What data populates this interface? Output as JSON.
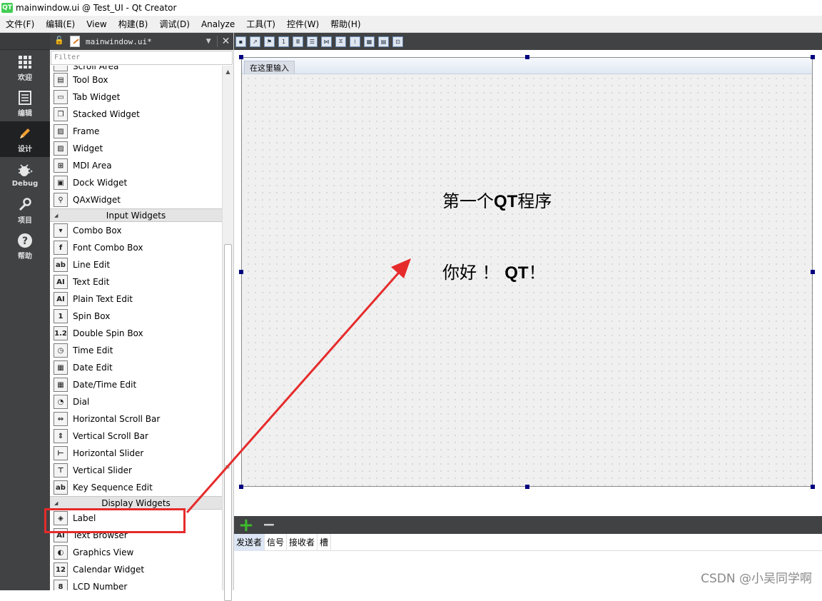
{
  "window": {
    "logo": "QT",
    "title": "mainwindow.ui @ Test_UI - Qt Creator"
  },
  "menubar": {
    "items": [
      "文件(F)",
      "编辑(E)",
      "View",
      "构建(B)",
      "调试(D)",
      "Analyze",
      "工具(T)",
      "控件(W)",
      "帮助(H)"
    ]
  },
  "modes": [
    {
      "label": "欢迎",
      "icon": "grid-icon",
      "active": false
    },
    {
      "label": "编辑",
      "icon": "document-icon",
      "active": false
    },
    {
      "label": "设计",
      "icon": "pencil-icon",
      "active": true
    },
    {
      "label": "Debug",
      "icon": "bug-icon",
      "active": false
    },
    {
      "label": "项目",
      "icon": "wrench-icon",
      "active": false
    },
    {
      "label": "帮助",
      "icon": "help-icon",
      "active": false
    }
  ],
  "editor": {
    "filename": "mainwindow.ui*",
    "filter_placeholder": "Filter"
  },
  "widget_box": {
    "partial_top": "Scroll Area",
    "containers": [
      {
        "label": "Tool Box",
        "glyph": "▤"
      },
      {
        "label": "Tab Widget",
        "glyph": "▭"
      },
      {
        "label": "Stacked Widget",
        "glyph": "❐"
      },
      {
        "label": "Frame",
        "glyph": "▨"
      },
      {
        "label": "Widget",
        "glyph": "▨"
      },
      {
        "label": "MDI Area",
        "glyph": "⊞"
      },
      {
        "label": "Dock Widget",
        "glyph": "▣"
      },
      {
        "label": "QAxWidget",
        "glyph": "⚲"
      }
    ],
    "input_category": "Input Widgets",
    "inputs": [
      {
        "label": "Combo Box",
        "glyph": "▾"
      },
      {
        "label": "Font Combo Box",
        "glyph": "f"
      },
      {
        "label": "Line Edit",
        "glyph": "ab"
      },
      {
        "label": "Text Edit",
        "glyph": "AI"
      },
      {
        "label": "Plain Text Edit",
        "glyph": "AI"
      },
      {
        "label": "Spin Box",
        "glyph": "1"
      },
      {
        "label": "Double Spin Box",
        "glyph": "1.2"
      },
      {
        "label": "Time Edit",
        "glyph": "◷"
      },
      {
        "label": "Date Edit",
        "glyph": "▦"
      },
      {
        "label": "Date/Time Edit",
        "glyph": "▦"
      },
      {
        "label": "Dial",
        "glyph": "◔"
      },
      {
        "label": "Horizontal Scroll Bar",
        "glyph": "⇔"
      },
      {
        "label": "Vertical Scroll Bar",
        "glyph": "⇕"
      },
      {
        "label": "Horizontal Slider",
        "glyph": "⊢"
      },
      {
        "label": "Vertical Slider",
        "glyph": "⊤"
      },
      {
        "label": "Key Sequence Edit",
        "glyph": "ab"
      }
    ],
    "display_category": "Display Widgets",
    "displays": [
      {
        "label": "Label",
        "glyph": "◈"
      },
      {
        "label": "Text Browser",
        "glyph": "AI"
      },
      {
        "label": "Graphics View",
        "glyph": "◐"
      },
      {
        "label": "Calendar Widget",
        "glyph": "12"
      },
      {
        "label": "LCD Number",
        "glyph": "8"
      }
    ]
  },
  "form": {
    "menu_placeholder": "在这里输入",
    "label1_pre": "第一个",
    "label1_bold": "QT",
    "label1_post": "程序",
    "label2_pre": "你好 ！ ",
    "label2_bold": "QT",
    "label2_post": "！"
  },
  "signals": {
    "add": "+",
    "remove": "−",
    "columns": [
      "发送者",
      "信号",
      "接收者",
      "槽"
    ]
  },
  "watermark": "CSDN @小吴同学啊",
  "colors": {
    "annotation_red": "#e62b2b",
    "mode_bar": "#404244",
    "selection_handle": "#000080"
  }
}
